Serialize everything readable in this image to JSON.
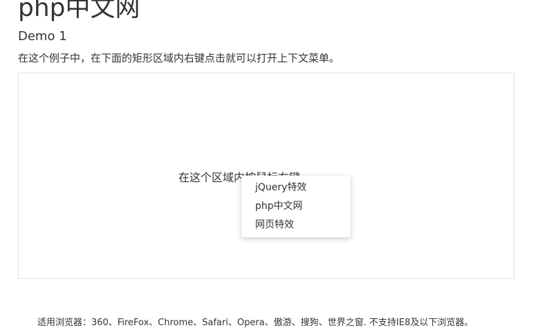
{
  "header": {
    "site_title": "php中文网",
    "demo_heading": "Demo 1",
    "intro": "在这个例子中，在下面的矩形区域内右键点击就可以打开上下文菜单。"
  },
  "demo_area": {
    "hint": "在这个区域内按鼠标右键"
  },
  "context_menu": {
    "items": [
      {
        "label": "jQuery特效"
      },
      {
        "label": "php中文网"
      },
      {
        "label": "网页特效"
      }
    ]
  },
  "footer": {
    "browser_support": "适用浏览器：360、FireFox、Chrome、Safari、Opera、傲游、搜狗、世界之窗. 不支持IE8及以下浏览器。"
  }
}
